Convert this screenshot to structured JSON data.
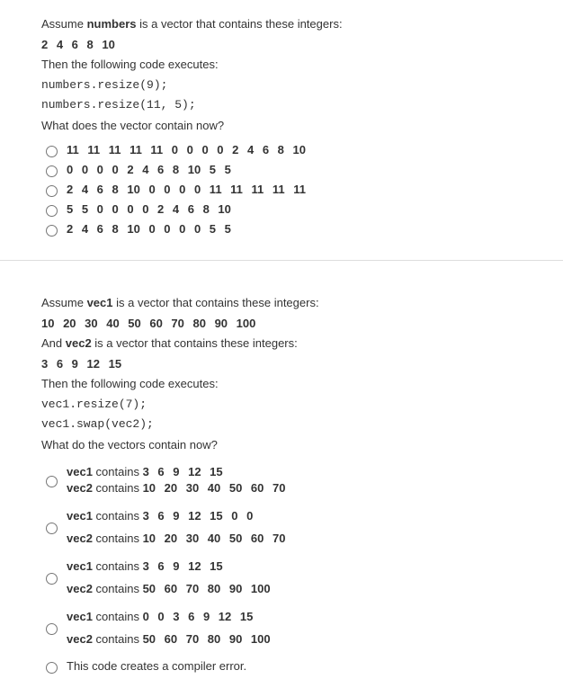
{
  "q1": {
    "intro1_pre": "Assume ",
    "intro1_bold": "numbers",
    "intro1_post": " is a vector that contains these integers:",
    "values": "2  4  6  8  10",
    "then": "Then the following code executes:",
    "code1": "numbers.resize(9);",
    "code2": "numbers.resize(11, 5);",
    "question": "What does the vector contain now?",
    "opts": [
      "11  11  11  11  11  0  0  0  0  2  4  6  8  10",
      "0  0  0  0  2  4  6  8  10  5  5",
      "2  4  6  8  10  0  0  0  0  11  11  11  11  11",
      "5  5  0  0  0  0  2  4  6  8  10",
      "2  4  6  8  10  0  0  0  0  5  5"
    ]
  },
  "q2": {
    "intro1_pre": "Assume ",
    "intro1_bold": "vec1",
    "intro1_post": " is a vector that contains these integers:",
    "vals1": "10  20  30  40  50  60  70  80  90  100",
    "intro2_pre": "And ",
    "intro2_bold": "vec2",
    "intro2_post": " is a vector that contains these integers:",
    "vals2": "3  6  9  12  15",
    "then": "Then the following code executes:",
    "code1": "vec1.resize(7);",
    "code2": "vec1.swap(vec2);",
    "question": "What do the vectors contain now?",
    "opts": {
      "a": {
        "l1_name": "vec1",
        "l1_text": " contains ",
        "l1_seq": "3  6  9  12  15",
        "l2_name": "vec2",
        "l2_text": " contains  ",
        "l2_seq": "10  20  30  40  50  60  70"
      },
      "b": {
        "l1_name": "vec1",
        "l1_text": " contains ",
        "l1_seq": "3  6  9  12  15  0  0",
        "l2_name": "vec2",
        "l2_text": " contains  ",
        "l2_seq": "10  20  30  40  50  60  70"
      },
      "c": {
        "l1_name": "vec1",
        "l1_text": " contains ",
        "l1_seq": "3  6  9  12  15",
        "l2_name": "vec2",
        "l2_text": " contains  ",
        "l2_seq": "50  60  70  80  90  100"
      },
      "d": {
        "l1_name": "vec1",
        "l1_text": " contains ",
        "l1_seq": "0  0  3  6  9  12  15",
        "l2_name": "vec2",
        "l2_text": " contains  ",
        "l2_seq": "50  60  70  80  90  100"
      },
      "e": "This code creates a compiler error."
    }
  }
}
